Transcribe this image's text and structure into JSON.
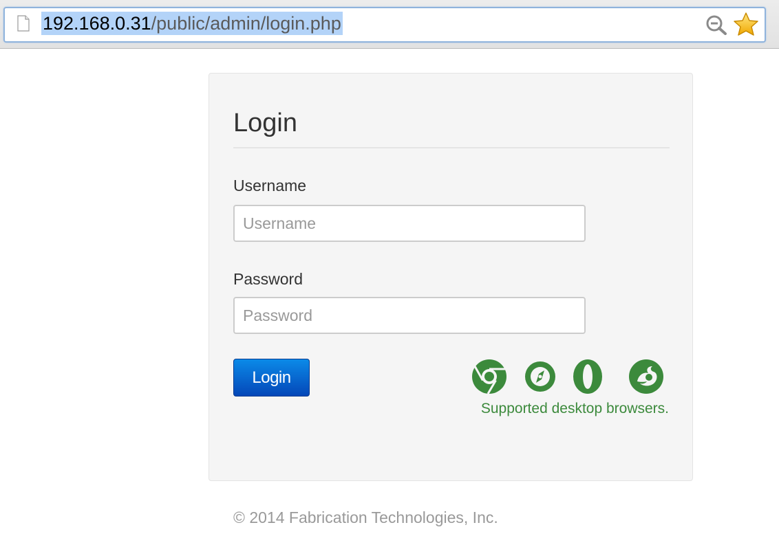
{
  "browser": {
    "url_host": "192.168.0.31",
    "url_path": "/public/admin/login.php",
    "icons": [
      "page-icon",
      "zoom-icon",
      "bookmark-star-icon"
    ]
  },
  "login": {
    "title": "Login",
    "username_label": "Username",
    "username_placeholder": "Username",
    "username_value": "",
    "password_label": "Password",
    "password_placeholder": "Password",
    "password_value": "",
    "button_label": "Login"
  },
  "supported": {
    "text": "Supported desktop browsers.",
    "browsers": [
      "chrome-icon",
      "safari-icon",
      "opera-icon",
      "firefox-icon"
    ],
    "color": "#3c8a3c"
  },
  "footer": {
    "copyright": "© 2014 Fabrication Technologies, Inc."
  },
  "colors": {
    "button": "#0b6fd6",
    "panel_bg": "#f5f5f5",
    "url_highlight": "#b3d3f8"
  }
}
